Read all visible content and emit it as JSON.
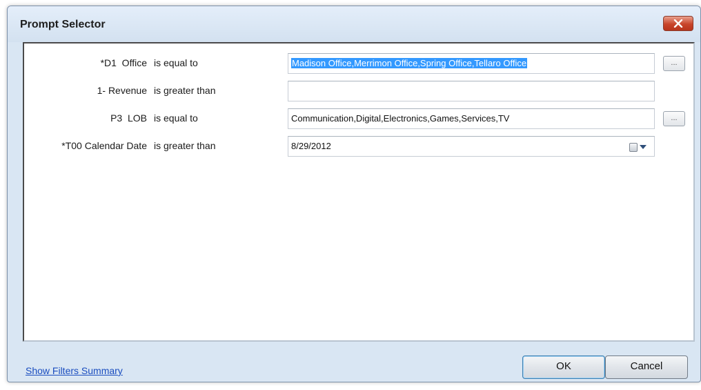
{
  "window": {
    "title": "Prompt Selector",
    "close_icon": "close-icon"
  },
  "prompts": [
    {
      "label": "*D1  Office",
      "operator": "is equal to",
      "value": "Madison Office,Merrimon Office,Spring Office,Tellaro Office",
      "selected": true,
      "has_picker": true
    },
    {
      "label": "1- Revenue",
      "operator": "is greater than",
      "value": "",
      "has_picker": false
    },
    {
      "label": "P3  LOB",
      "operator": "is equal to",
      "value": "Communication,Digital,Electronics,Games,Services,TV",
      "has_picker": true
    },
    {
      "label": "*T00 Calendar Date",
      "operator": "is greater than",
      "value": "8/29/2012",
      "has_date_dropdown": true
    }
  ],
  "picker_label": "...",
  "footer": {
    "summary_link": "Show Filters Summary",
    "ok_label": "OK",
    "cancel_label": "Cancel"
  },
  "colors": {
    "selection": "#3399ff",
    "link": "#1a4dbf",
    "close_button": "#c8452b"
  }
}
